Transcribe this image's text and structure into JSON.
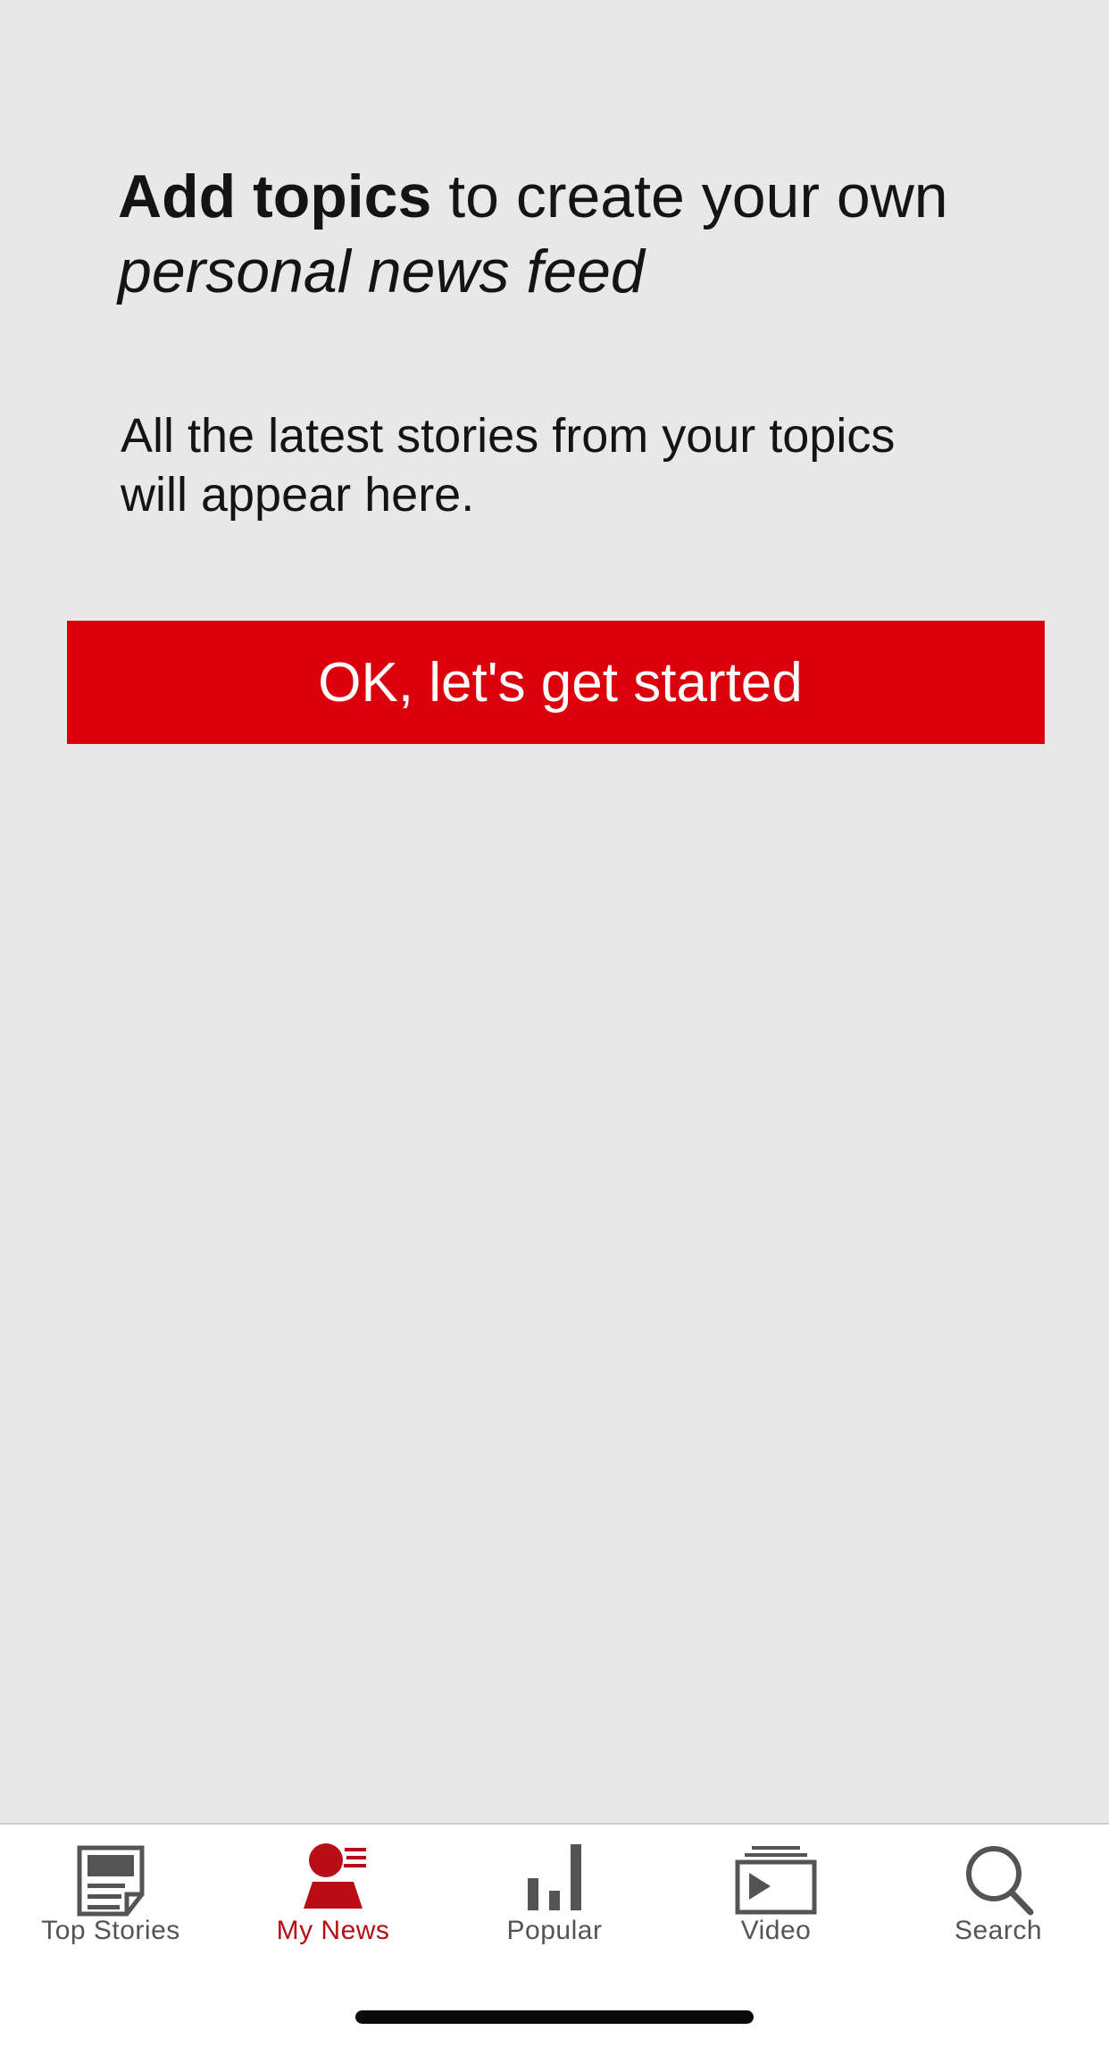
{
  "onboarding": {
    "headline_bold": "Add topics",
    "headline_rest": " to create your own",
    "headline_italic": "personal news feed",
    "subtext_line1": "All the latest stories from your topics",
    "subtext_line2": "will appear here.",
    "cta_label": "OK, let's get started"
  },
  "tabbar": {
    "items": [
      {
        "label": "Top Stories",
        "icon": "newspaper-icon",
        "active": false
      },
      {
        "label": "My News",
        "icon": "person-feed-icon",
        "active": true
      },
      {
        "label": "Popular",
        "icon": "bar-chart-icon",
        "active": false
      },
      {
        "label": "Video",
        "icon": "video-play-icon",
        "active": false
      },
      {
        "label": "Search",
        "icon": "search-icon",
        "active": false
      }
    ]
  },
  "colors": {
    "background": "#e8e8e8",
    "accent": "#db000b",
    "active_tab": "#b80d14",
    "inactive_tab": "#545454"
  }
}
